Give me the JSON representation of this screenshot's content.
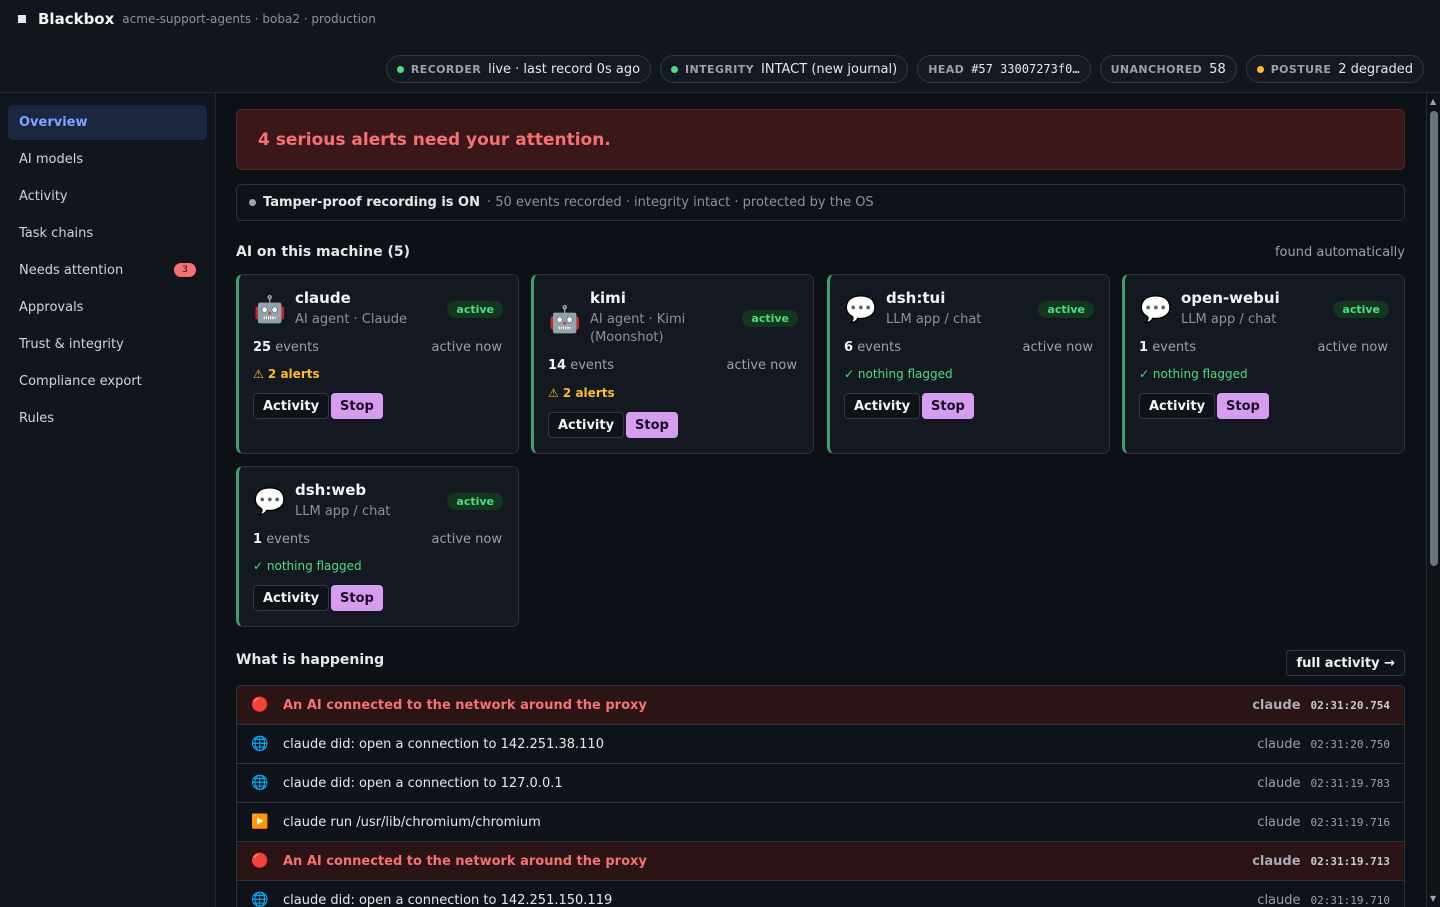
{
  "app": {
    "name": "Blackbox",
    "context": "acme-support-agents · boba2 · production"
  },
  "status_pills": [
    {
      "key": "RECORDER",
      "value": "live · last record 0s ago",
      "dot": "#4ade80"
    },
    {
      "key": "INTEGRITY",
      "value": "INTACT (new journal)",
      "dot": "#4ade80"
    },
    {
      "key": "HEAD",
      "value": "#57 33007273f0…"
    },
    {
      "key": "UNANCHORED",
      "value": "58"
    },
    {
      "key": "POSTURE",
      "value": "2 degraded",
      "dot": "#fbbf24"
    }
  ],
  "sidebar": {
    "items": [
      {
        "label": "Overview",
        "active": true
      },
      {
        "label": "AI models"
      },
      {
        "label": "Activity"
      },
      {
        "label": "Task chains"
      },
      {
        "label": "Needs attention",
        "badge": "3"
      },
      {
        "label": "Approvals"
      },
      {
        "label": "Trust & integrity"
      },
      {
        "label": "Compliance export"
      },
      {
        "label": "Rules"
      }
    ]
  },
  "alert_banner": "4 serious alerts need your attention.",
  "recording": {
    "title": "Tamper-proof recording is ON",
    "detail": "· 50 events recorded · integrity intact · protected by the OS"
  },
  "ai_section": {
    "title": "AI on this machine (5)",
    "note": "found automatically"
  },
  "agents": [
    {
      "name": "claude",
      "sub": "AI agent · Claude",
      "icon": "robot-icon",
      "glyph": "🤖",
      "status": "active",
      "events": "25",
      "events_label": "events",
      "when": "active now",
      "flag": "⚠ 2 alerts",
      "flag_type": "warn",
      "activity_label": "Activity",
      "stop_label": "Stop"
    },
    {
      "name": "kimi",
      "sub": "AI agent · Kimi (Moonshot)",
      "icon": "robot-icon",
      "glyph": "🤖",
      "status": "active",
      "events": "14",
      "events_label": "events",
      "when": "active now",
      "flag": "⚠ 2 alerts",
      "flag_type": "warn",
      "activity_label": "Activity",
      "stop_label": "Stop"
    },
    {
      "name": "dsh:tui",
      "sub": "LLM app / chat",
      "icon": "chat-bubble-icon",
      "glyph": "💬",
      "status": "active",
      "events": "6",
      "events_label": "events",
      "when": "active now",
      "flag": "✓ nothing flagged",
      "flag_type": "ok",
      "activity_label": "Activity",
      "stop_label": "Stop"
    },
    {
      "name": "open-webui",
      "sub": "LLM app / chat",
      "icon": "chat-bubble-icon",
      "glyph": "💬",
      "status": "active",
      "events": "1",
      "events_label": "events",
      "when": "active now",
      "flag": "✓ nothing flagged",
      "flag_type": "ok",
      "activity_label": "Activity",
      "stop_label": "Stop"
    },
    {
      "name": "dsh:web",
      "sub": "LLM app / chat",
      "icon": "chat-bubble-icon",
      "glyph": "💬",
      "status": "active",
      "events": "1",
      "events_label": "events",
      "when": "active now",
      "flag": "✓ nothing flagged",
      "flag_type": "ok",
      "activity_label": "Activity",
      "stop_label": "Stop"
    }
  ],
  "happening": {
    "title": "What is happening",
    "full_label": "full activity →"
  },
  "events": [
    {
      "icon": "red-circle-icon",
      "glyph": "🔴",
      "text": "An AI connected to the network around the proxy",
      "agent": "claude",
      "time": "02:31:20.754",
      "alert": true
    },
    {
      "icon": "globe-icon",
      "glyph": "🌐",
      "text": "claude did: open a connection to 142.251.38.110",
      "agent": "claude",
      "time": "02:31:20.750",
      "alert": false
    },
    {
      "icon": "globe-icon",
      "glyph": "🌐",
      "text": "claude did: open a connection to 127.0.0.1",
      "agent": "claude",
      "time": "02:31:19.783",
      "alert": false
    },
    {
      "icon": "play-icon",
      "glyph": "▶️",
      "text": "claude run /usr/lib/chromium/chromium",
      "agent": "claude",
      "time": "02:31:19.716",
      "alert": false
    },
    {
      "icon": "red-circle-icon",
      "glyph": "🔴",
      "text": "An AI connected to the network around the proxy",
      "agent": "claude",
      "time": "02:31:19.713",
      "alert": true
    },
    {
      "icon": "globe-icon",
      "glyph": "🌐",
      "text": "claude did: open a connection to 142.251.150.119",
      "agent": "claude",
      "time": "02:31:19.710",
      "alert": false
    }
  ]
}
